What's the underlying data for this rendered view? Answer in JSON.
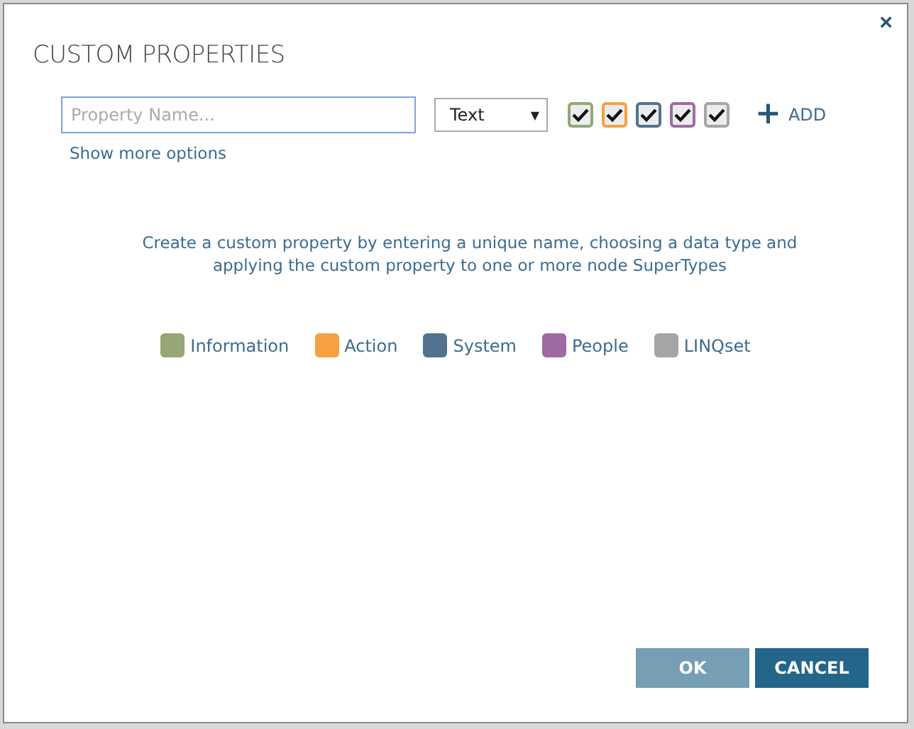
{
  "dialog": {
    "title": "CUSTOM PROPERTIES",
    "close": "×",
    "name_field": {
      "placeholder": "Property Name..."
    },
    "type_select": {
      "value": "Text",
      "caret": "▼"
    },
    "supertype_checks": [
      {
        "color": "#94a774",
        "checked": true
      },
      {
        "color": "#f5a142",
        "checked": true
      },
      {
        "color": "#52728f",
        "checked": true
      },
      {
        "color": "#9f6aa3",
        "checked": true
      },
      {
        "color": "#a5a5a7",
        "checked": true
      }
    ],
    "add": {
      "icon": "+",
      "label": "ADD"
    },
    "more_link": "Show more options",
    "description": "Create a custom property by entering a unique name, choosing a data type and applying the custom property to one or more node SuperTypes",
    "legend": [
      {
        "label": "Information",
        "color": "#94a774"
      },
      {
        "label": "Action",
        "color": "#f5a142"
      },
      {
        "label": "System",
        "color": "#52728f"
      },
      {
        "label": "People",
        "color": "#9f6aa3"
      },
      {
        "label": "LINQset",
        "color": "#a5a5a7"
      }
    ],
    "buttons": [
      {
        "label": "OK",
        "kind": "primary",
        "disabled": true
      },
      {
        "label": "CANCEL",
        "kind": "primary",
        "disabled": false
      }
    ]
  }
}
